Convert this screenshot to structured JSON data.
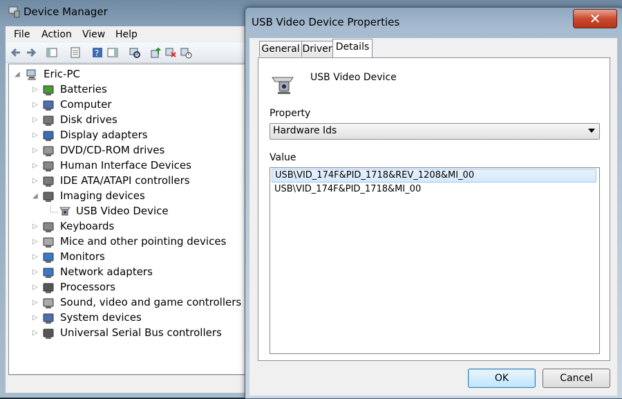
{
  "device_manager": {
    "title": "Device Manager",
    "menu": [
      "File",
      "Action",
      "View",
      "Help"
    ],
    "toolbar_icons": [
      "back-icon",
      "forward-icon",
      "show-hide-console-tree-icon",
      "properties-icon",
      "help-icon",
      "action-pane-icon",
      "scan-hardware-icon",
      "update-driver-icon",
      "uninstall-icon",
      "disable-icon"
    ],
    "tree": {
      "root": "Eric-PC",
      "categories": [
        {
          "label": "Batteries",
          "icon": "battery-icon"
        },
        {
          "label": "Computer",
          "icon": "computer-icon"
        },
        {
          "label": "Disk drives",
          "icon": "disk-drive-icon"
        },
        {
          "label": "Display adapters",
          "icon": "display-adapter-icon"
        },
        {
          "label": "DVD/CD-ROM drives",
          "icon": "dvd-drive-icon"
        },
        {
          "label": "Human Interface Devices",
          "icon": "hid-icon"
        },
        {
          "label": "IDE ATA/ATAPI controllers",
          "icon": "ide-controller-icon"
        },
        {
          "label": "Imaging devices",
          "icon": "camera-icon",
          "expanded": true,
          "children": [
            "USB Video Device"
          ]
        },
        {
          "label": "Keyboards",
          "icon": "keyboard-icon"
        },
        {
          "label": "Mice and other pointing devices",
          "icon": "mouse-icon"
        },
        {
          "label": "Monitors",
          "icon": "monitor-icon"
        },
        {
          "label": "Network adapters",
          "icon": "network-icon"
        },
        {
          "label": "Processors",
          "icon": "processor-icon"
        },
        {
          "label": "Sound, video and game controllers",
          "icon": "speaker-icon"
        },
        {
          "label": "System devices",
          "icon": "system-device-icon"
        },
        {
          "label": "Universal Serial Bus controllers",
          "icon": "usb-icon"
        }
      ]
    }
  },
  "dialog": {
    "title": "USB Video Device Properties",
    "close_label": "✕",
    "tabs": [
      "General",
      "Driver",
      "Details"
    ],
    "active_tab": "Details",
    "device_name": "USB Video Device",
    "property_label": "Property",
    "property_value": "Hardware Ids",
    "value_label": "Value",
    "values": [
      "USB\\VID_174F&PID_1718&REV_1208&MI_00",
      "USB\\VID_174F&PID_1718&MI_00"
    ],
    "ok_label": "OK",
    "cancel_label": "Cancel"
  }
}
